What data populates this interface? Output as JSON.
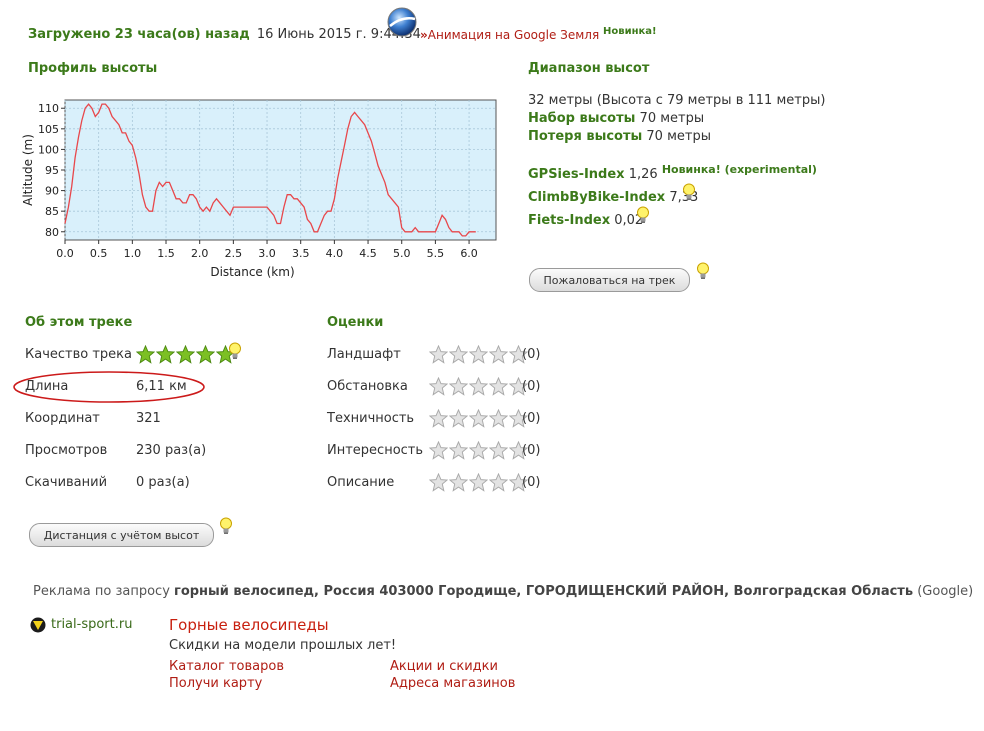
{
  "header": {
    "uploaded_label": "Загружено 23 часа(ов) назад",
    "date": "16 Июнь 2015 г. 9:44:34",
    "arrows": "»",
    "animation_link": "Анимация на Google Земля",
    "new_badge": "Новинка!"
  },
  "profile": {
    "title": "Профиль высоты"
  },
  "chart_data": {
    "type": "line",
    "xlabel": "Distance (km)",
    "ylabel": "Altitude (m)",
    "xlim": [
      0,
      6.4
    ],
    "ylim": [
      78,
      112
    ],
    "xticks": [
      "0.0",
      "0.5",
      "1.0",
      "1.5",
      "2.0",
      "2.5",
      "3.0",
      "3.5",
      "4.0",
      "4.5",
      "5.0",
      "5.5",
      "6.0"
    ],
    "yticks": [
      "80",
      "85",
      "90",
      "95",
      "100",
      "105",
      "110"
    ],
    "grid": true,
    "colors": {
      "line": "#e8474b",
      "background": "#d9f0fb",
      "grid": "#a9c7d9"
    },
    "x": [
      0.0,
      0.05,
      0.1,
      0.15,
      0.2,
      0.25,
      0.3,
      0.35,
      0.4,
      0.45,
      0.5,
      0.55,
      0.6,
      0.65,
      0.7,
      0.75,
      0.8,
      0.85,
      0.9,
      0.95,
      1.0,
      1.05,
      1.1,
      1.15,
      1.2,
      1.25,
      1.3,
      1.35,
      1.4,
      1.45,
      1.5,
      1.55,
      1.6,
      1.65,
      1.7,
      1.75,
      1.8,
      1.85,
      1.9,
      1.95,
      2.0,
      2.05,
      2.1,
      2.15,
      2.2,
      2.25,
      2.3,
      2.35,
      2.4,
      2.45,
      2.5,
      2.6,
      2.7,
      2.8,
      2.9,
      3.0,
      3.05,
      3.1,
      3.15,
      3.2,
      3.25,
      3.3,
      3.35,
      3.4,
      3.45,
      3.5,
      3.55,
      3.6,
      3.65,
      3.7,
      3.75,
      3.8,
      3.85,
      3.9,
      3.95,
      4.0,
      4.05,
      4.1,
      4.15,
      4.2,
      4.25,
      4.3,
      4.35,
      4.4,
      4.45,
      4.5,
      4.55,
      4.6,
      4.65,
      4.7,
      4.75,
      4.8,
      4.85,
      4.9,
      4.95,
      5.0,
      5.05,
      5.1,
      5.15,
      5.2,
      5.25,
      5.3,
      5.35,
      5.4,
      5.45,
      5.5,
      5.55,
      5.6,
      5.65,
      5.7,
      5.75,
      5.8,
      5.85,
      5.9,
      5.95,
      6.0,
      6.05,
      6.1
    ],
    "values": [
      82,
      86,
      91,
      98,
      103,
      107,
      110,
      111,
      110,
      108,
      109,
      111,
      111,
      110,
      108,
      107,
      106,
      104,
      104,
      102,
      101,
      98,
      94,
      89,
      86,
      85,
      85,
      90,
      92,
      91,
      92,
      92,
      90,
      88,
      88,
      87,
      87,
      89,
      89,
      88,
      86,
      85,
      86,
      85,
      87,
      88,
      87,
      86,
      85,
      84,
      86,
      86,
      86,
      86,
      86,
      86,
      85,
      84,
      82,
      82,
      86,
      89,
      89,
      88,
      88,
      87,
      86,
      83,
      82,
      80,
      80,
      82,
      84,
      85,
      85,
      88,
      93,
      97,
      101,
      105,
      108,
      109,
      108,
      107,
      106,
      104,
      102,
      99,
      96,
      94,
      92,
      89,
      88,
      87,
      86,
      81,
      80,
      80,
      80,
      81,
      80,
      80,
      80,
      80,
      80,
      80,
      82,
      84,
      83,
      81,
      80,
      80,
      80,
      79,
      79,
      80,
      80,
      80
    ]
  },
  "range": {
    "title": "Диапазон высот",
    "summary": "32 метры (Высота с 79 метры в 111 метры)",
    "gain_label": "Набор высоты",
    "gain_value": "70 метры",
    "loss_label": "Потеря высоты",
    "loss_value": "70 метры",
    "gpsies_label": "GPSies-Index",
    "gpsies_value": "1,26",
    "gpsies_new": "Новинка! (experimental)",
    "climb_label": "ClimbByBike-Index",
    "climb_value": "7,33",
    "fiets_label": "Fiets-Index",
    "fiets_value": "0,02",
    "complain_button": "Пожаловаться на трек"
  },
  "about": {
    "title": "Об этом треке",
    "rows": [
      {
        "label": "Качество трека",
        "value": ""
      },
      {
        "label": "Длина",
        "value": "6,11 км"
      },
      {
        "label": "Координат",
        "value": "321"
      },
      {
        "label": "Просмотров",
        "value": "230 раз(а)"
      },
      {
        "label": "Скачиваний",
        "value": "0 раз(а)"
      }
    ],
    "quality_stars": 5,
    "distance_button": "Дистанция с учётом высот"
  },
  "ratings": {
    "title": "Оценки",
    "rows": [
      {
        "label": "Ландшафт",
        "stars": 0,
        "count": "(0)"
      },
      {
        "label": "Обстановка",
        "stars": 0,
        "count": "(0)"
      },
      {
        "label": "Техничность",
        "stars": 0,
        "count": "(0)"
      },
      {
        "label": "Интересность",
        "stars": 0,
        "count": "(0)"
      },
      {
        "label": "Описание",
        "stars": 0,
        "count": "(0)"
      }
    ]
  },
  "ads": {
    "query_prefix": "Реклама по запросу",
    "query": "горный велосипед, Россия 403000 Городище, ГОРОДИЩЕНСКИЙ РАЙОН, Волгоградская Область",
    "provider": "(Google)",
    "site": "trial-sport.ru",
    "headline": "Горные велосипеды",
    "tagline": "Скидки на модели прошлых лет!",
    "links": [
      "Каталог товаров",
      "Акции и скидки",
      "Получи карту",
      "Адреса магазинов"
    ]
  }
}
